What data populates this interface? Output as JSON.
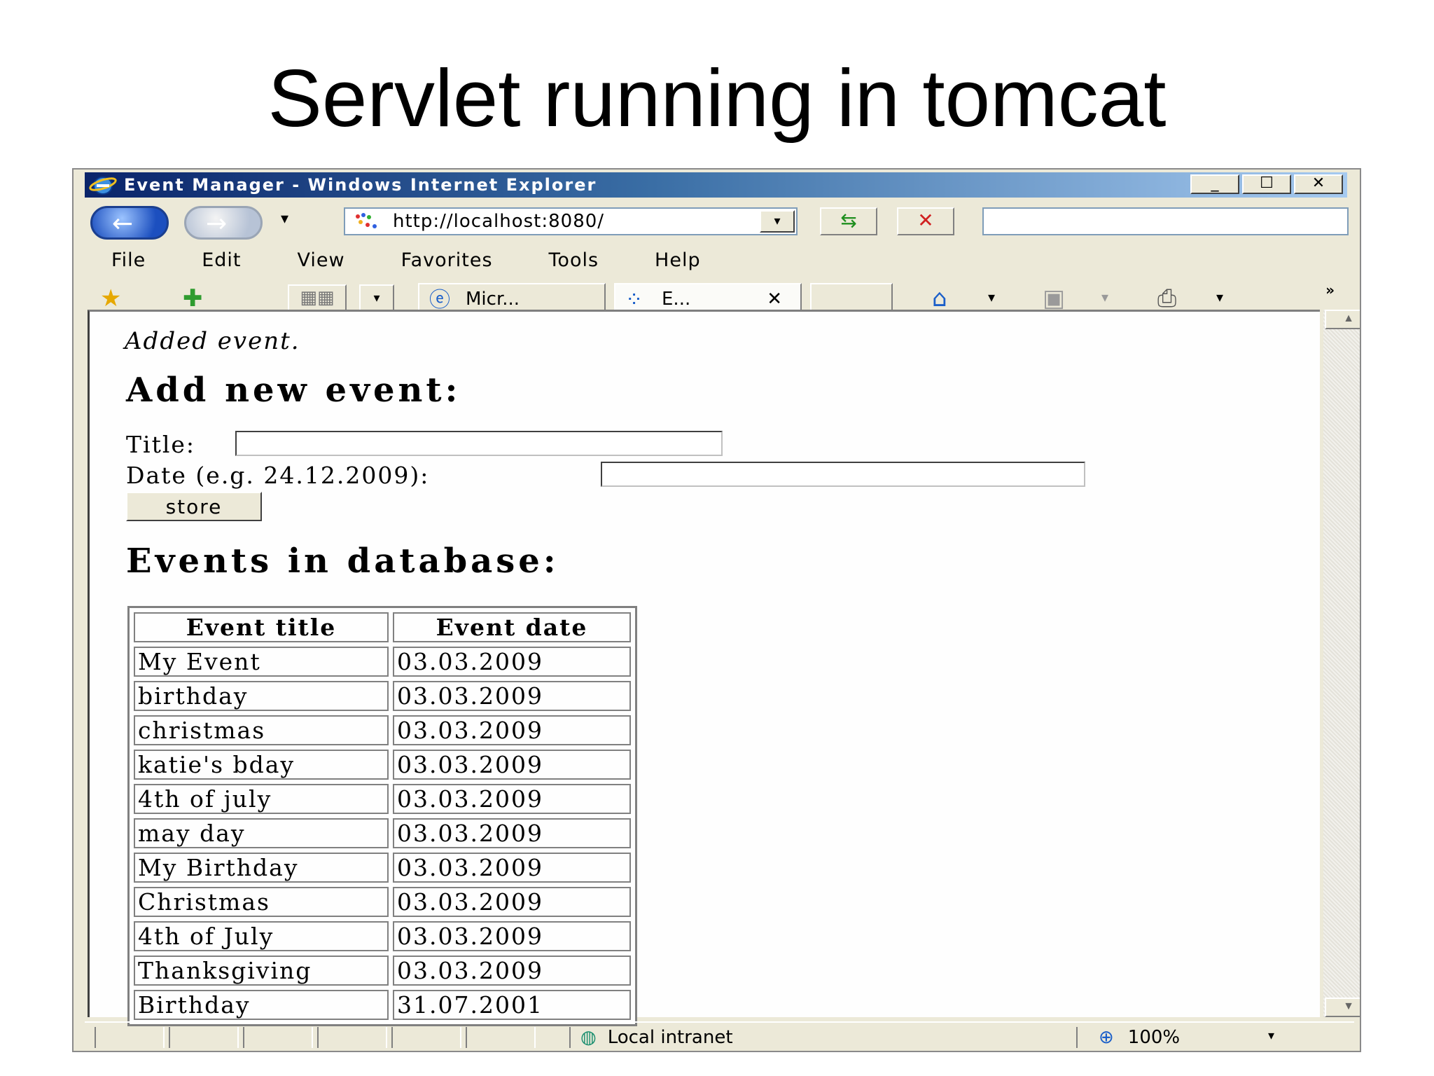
{
  "slide": {
    "title": "Servlet running in tomcat"
  },
  "window": {
    "title": "Event Manager - Windows Internet Explorer",
    "buttons": {
      "minimize": "_",
      "maximize": "☐",
      "close": "✕"
    }
  },
  "toolbar": {
    "address": "http://localhost:8080/",
    "search_value": "",
    "dropdown_glyph": "▾",
    "refresh_glyph": "⇆",
    "stop_glyph": "✕"
  },
  "menu": {
    "items": [
      "File",
      "Edit",
      "View",
      "Favorites",
      "Tools",
      "Help"
    ]
  },
  "tabs": {
    "items": [
      {
        "label": "Micr..."
      },
      {
        "label": "E...",
        "close": "✕"
      }
    ],
    "chevron": "»"
  },
  "icons": {
    "back": "back-arrow-icon",
    "forward": "forward-arrow-icon",
    "favorites": "star-icon",
    "add_favorite": "add-favorite-icon",
    "home": "home-icon",
    "feeds": "feeds-icon",
    "print": "print-icon",
    "globe": "globe-icon",
    "zoom": "magnifier-icon"
  },
  "page": {
    "message": "Added event.",
    "add_heading": "Add new event:",
    "title_label": "Title:",
    "date_label": "Date (e.g. 24.12.2009):",
    "title_value": "",
    "date_value": "",
    "store_label": "store",
    "events_heading": "Events in database:",
    "table": {
      "headers": [
        "Event title",
        "Event date"
      ],
      "rows": [
        [
          "My Event",
          "03.03.2009"
        ],
        [
          "birthday",
          "03.03.2009"
        ],
        [
          "christmas",
          "03.03.2009"
        ],
        [
          "katie's bday",
          "03.03.2009"
        ],
        [
          "4th of july",
          "03.03.2009"
        ],
        [
          "may day",
          "03.03.2009"
        ],
        [
          "My Birthday",
          "03.03.2009"
        ],
        [
          "Christmas",
          "03.03.2009"
        ],
        [
          "4th of July",
          "03.03.2009"
        ],
        [
          "Thanksgiving",
          "03.03.2009"
        ],
        [
          "Birthday",
          "31.07.2001"
        ]
      ]
    }
  },
  "statusbar": {
    "zone": "Local intranet",
    "zoom": "100%"
  }
}
